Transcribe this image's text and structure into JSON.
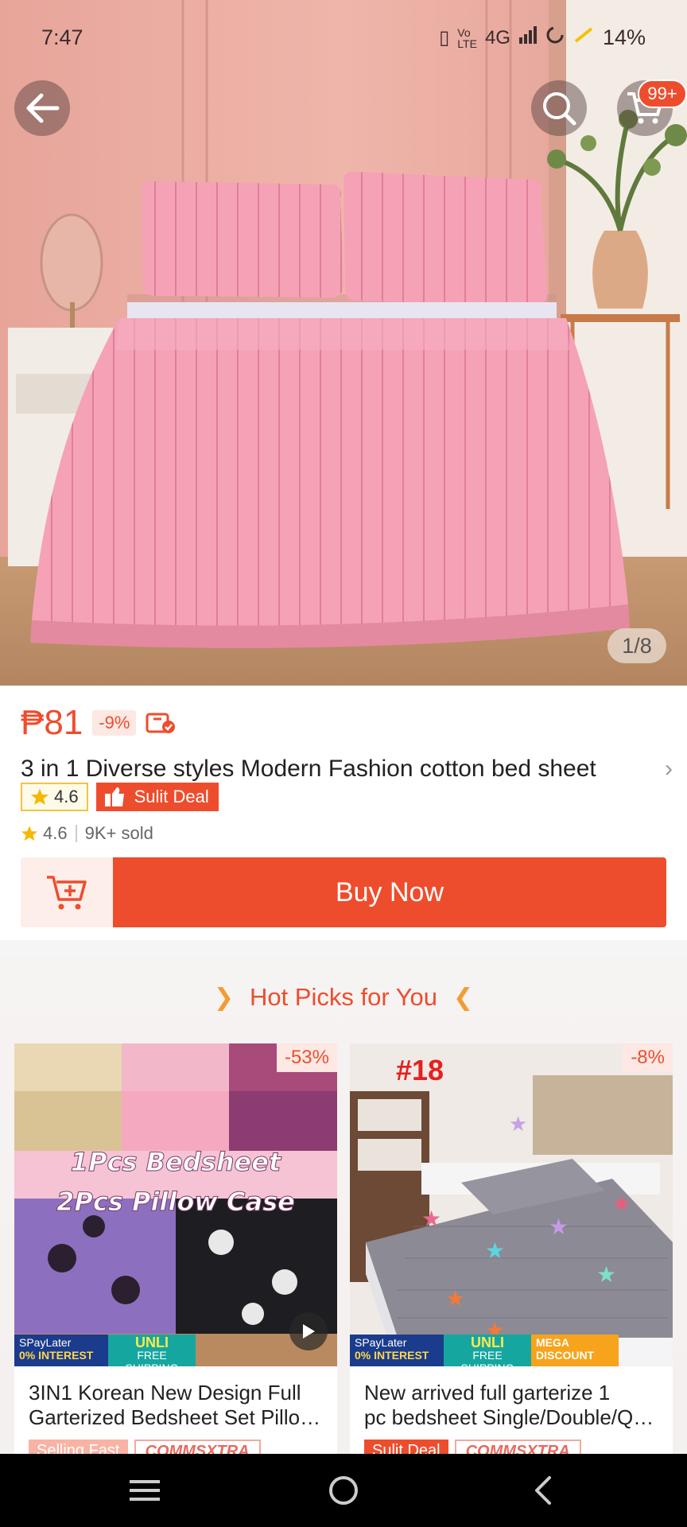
{
  "status_bar": {
    "time": "7:47",
    "network": "4G",
    "battery": "14%"
  },
  "header": {
    "cart_badge": "99+",
    "image_counter": "1/8"
  },
  "product": {
    "price": "₱81",
    "discount": "-9%",
    "title": "3 in 1 Diverse styles Modern Fashion cotton bed sheet",
    "rating_badge": "4.6",
    "deal_label": "Sulit Deal",
    "rating": "4.6",
    "sold": "9K+ sold",
    "buy_now_label": "Buy Now"
  },
  "hot_picks": {
    "title": "Hot Picks for You",
    "items": [
      {
        "discount": "-53%",
        "image_text_1": "1Pcs Bedsheet",
        "image_text_2": "2Pcs Pillow Case",
        "name_line1": "3IN1 Korean New Design Full",
        "name_line2": "Garterized Bedsheet Set Pillowcase",
        "tag1": "Selling Fast",
        "tag2": "COMMSXTRA"
      },
      {
        "discount": "-8%",
        "image_text_1": "#18",
        "name_line1": "New arrived full garterize 1",
        "name_line2": "pc bedsheet  Single/Double/Queen",
        "tag1": "Sulit Deal",
        "tag2": "COMMSXTRA"
      }
    ],
    "promo": {
      "spay_1": "SPayLater",
      "spay_2": "0% INTEREST",
      "unli_1": "UNLI",
      "unli_2": "FREE SHIPPING",
      "mega_1": "MEGA",
      "mega_2": "DISCOUNT"
    }
  },
  "colors": {
    "accent": "#ee4d2d",
    "deal_badge_border": "#f5c242"
  },
  "icons": [
    "back-arrow-icon",
    "search-icon",
    "cart-icon",
    "voucher-icon",
    "star-icon",
    "add-to-cart-icon",
    "play-icon",
    "menu-icon",
    "home-icon",
    "nav-back-icon"
  ]
}
